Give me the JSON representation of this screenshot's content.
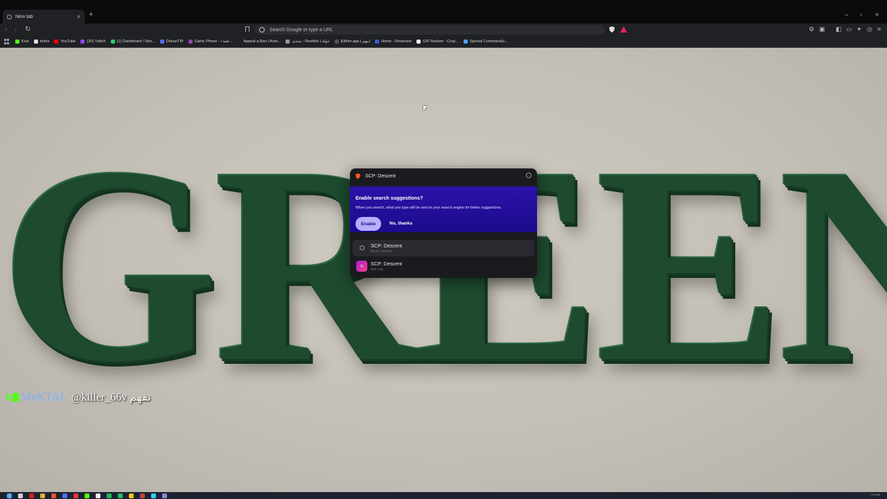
{
  "browser": {
    "tab_title": "New tab",
    "tab_close": "×",
    "new_tab": "+",
    "window_controls": {
      "minimize": "–",
      "restore": "▫",
      "close": "×"
    },
    "nav": {
      "back": "‹",
      "forward": "›",
      "reload": "↻"
    },
    "omnibox_placeholder": "Search Google or type a URL",
    "tool_icons": [
      "extensions-icon",
      "wallet-icon",
      "sidebar-icon",
      "leo-icon",
      "vpn-icon",
      "menu-icon"
    ]
  },
  "bookmarks": [
    {
      "label": "Kick",
      "color": "#53fc18"
    },
    {
      "label": "botrix",
      "color": "#dddddd"
    },
    {
      "label": "YouTube",
      "color": "#ff0000"
    },
    {
      "label": "(20) Twitch",
      "color": "#9146ff"
    },
    {
      "label": "(1) Dashboard / Stre...",
      "color": "#2ecc71"
    },
    {
      "label": "DokanTIP",
      "color": "#4f6df5"
    },
    {
      "label": "Gartic Phone - لعبة ا...",
      "color": "#8e44ad"
    },
    {
      "label": "Appeal a Ban | Activ...",
      "color": "#222222"
    },
    {
      "label": "منتدى - Rewfish | جولة",
      "color": "#999999"
    },
    {
      "label": "Elbhm.app | ابيهم",
      "color": "#555555"
    },
    {
      "label": "Home - Restream",
      "color": "#3b5bdb"
    },
    {
      "label": "GIF Resizer - Crop...",
      "color": "#eeeeee"
    },
    {
      "label": "Special Command(s...",
      "color": "#4aa3ff"
    }
  ],
  "page": {
    "wordmark": "GREEN"
  },
  "popup": {
    "query": "SCP: Descent",
    "suggest_title": "Enable search suggestions?",
    "suggest_desc": "When you search, what you type will be sent to your search engine for better suggestions.",
    "enable_label": "Enable",
    "no_thanks_label": "No, thanks",
    "results": [
      {
        "title": "SCP: Descent",
        "subtitle": "Brave Search",
        "icon": "search-icon"
      },
      {
        "title": "SCP: Descent",
        "subtitle": "Ask Leo",
        "icon": "leo-icon"
      }
    ]
  },
  "overlay": {
    "brand": "K",
    "user": "MeKTAL",
    "handle": "@killer_66v تفهم"
  },
  "taskbar": {
    "clock": "7:29 AM",
    "icon_colors": [
      "#5aa9ff",
      "#d0d0d0",
      "#c22",
      "#e0b030",
      "#e05a2b",
      "#4f6df5",
      "#e33",
      "#53fc18",
      "#eee",
      "#1db954",
      "#2b6",
      "#f5c518",
      "#b44",
      "#3cf",
      "#88c"
    ]
  }
}
